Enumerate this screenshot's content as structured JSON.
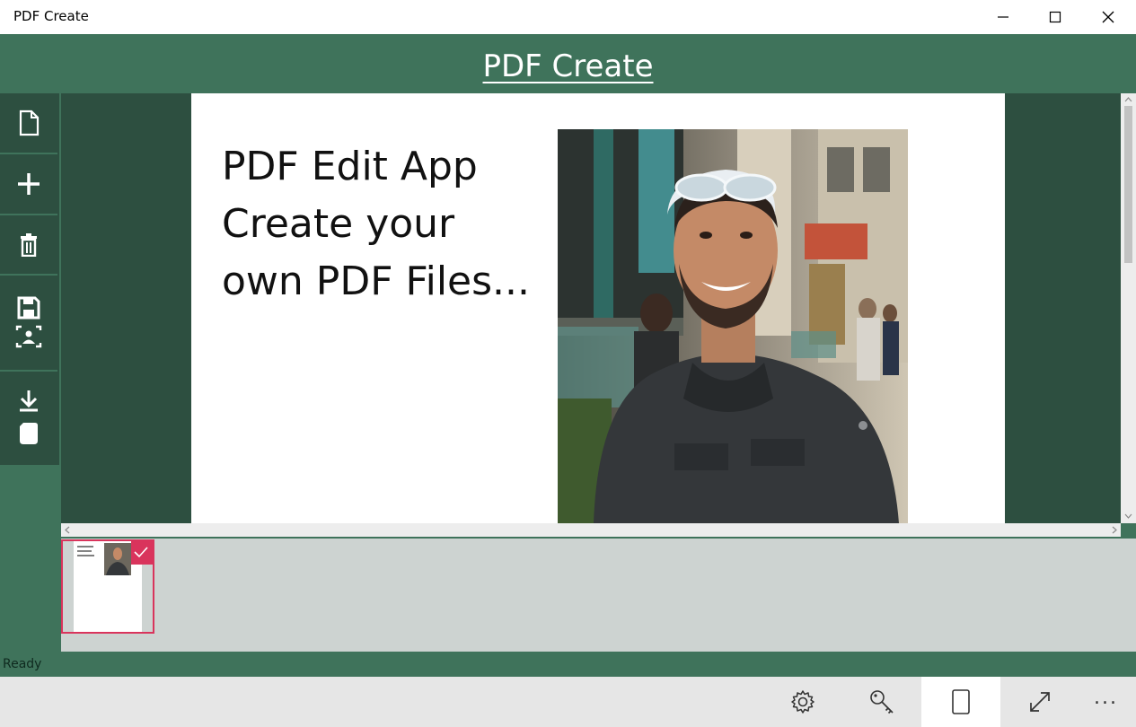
{
  "window": {
    "title": "PDF Create",
    "controls": [
      "minimize-icon",
      "maximize-icon",
      "close-icon"
    ]
  },
  "header": {
    "app_title": "PDF Create"
  },
  "sidebar": {
    "items": [
      {
        "name": "new-document",
        "icon": "document-icon"
      },
      {
        "name": "add-page",
        "icon": "plus-icon"
      },
      {
        "name": "delete-page",
        "icon": "trash-icon"
      },
      {
        "name": "save-image",
        "icon": "save-icon"
      },
      {
        "name": "download-file",
        "icon": "download-icon"
      }
    ]
  },
  "document": {
    "text_lines": [
      "PDF Edit App",
      "Create your",
      "own PDF Files..."
    ],
    "photo": "portrait-photo"
  },
  "thumbnails": {
    "selected_index": 0,
    "count": 1
  },
  "status": {
    "text": "Ready"
  },
  "bottombar": {
    "items": [
      {
        "name": "settings",
        "icon": "gear-icon"
      },
      {
        "name": "key",
        "icon": "key-icon"
      },
      {
        "name": "page-orientation",
        "icon": "page-portrait-icon",
        "active": true
      },
      {
        "name": "fullscreen",
        "icon": "expand-icon"
      }
    ],
    "more_label": "..."
  },
  "colors": {
    "header_green": "#3f735b",
    "dark_green": "#2d4f40",
    "thumb_strip": "#cdd3d1",
    "selection_accent": "#d9345c"
  }
}
